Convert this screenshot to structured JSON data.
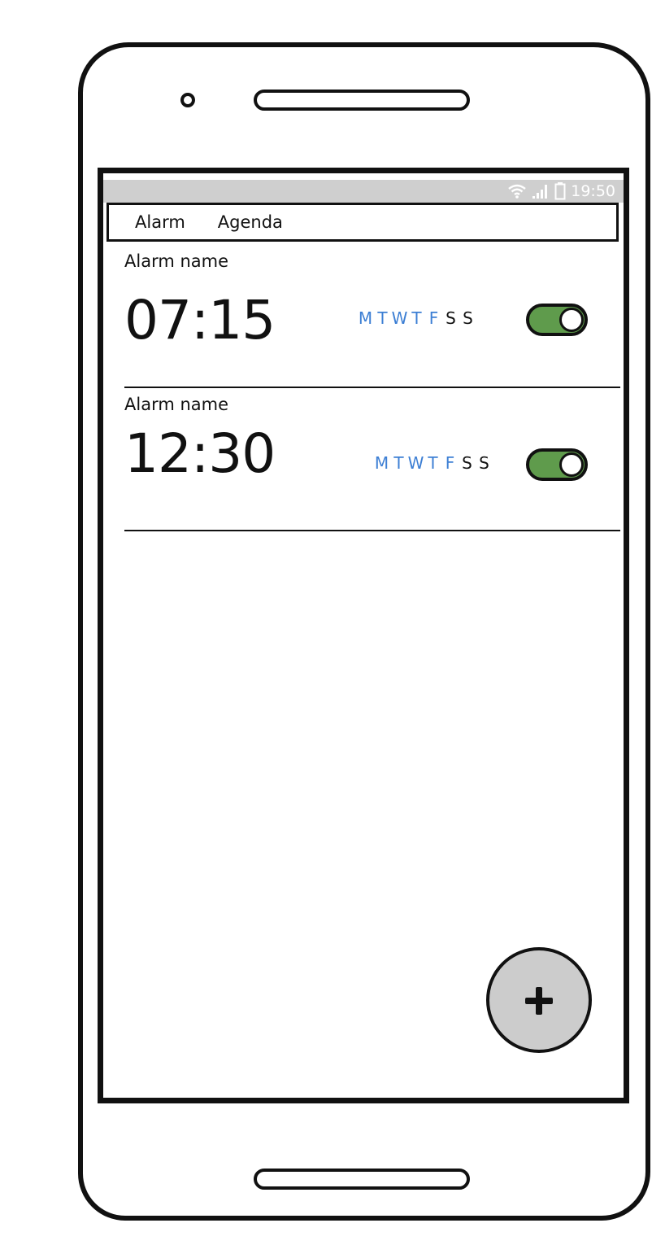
{
  "status_bar": {
    "time": "19:50",
    "icons": [
      "wifi-icon",
      "signal-icon",
      "battery-icon"
    ]
  },
  "tabs": [
    {
      "label": "Alarm"
    },
    {
      "label": "Agenda"
    }
  ],
  "alarms": [
    {
      "name": "Alarm name",
      "time": "07:15",
      "days": [
        {
          "letter": "M",
          "active": true
        },
        {
          "letter": "T",
          "active": true
        },
        {
          "letter": "W",
          "active": true
        },
        {
          "letter": "T",
          "active": true
        },
        {
          "letter": "F",
          "active": true
        },
        {
          "letter": "S",
          "active": false
        },
        {
          "letter": "S",
          "active": false
        }
      ],
      "enabled": true
    },
    {
      "name": "Alarm name",
      "time": "12:30",
      "days": [
        {
          "letter": "M",
          "active": true
        },
        {
          "letter": "T",
          "active": true
        },
        {
          "letter": "W",
          "active": true
        },
        {
          "letter": "T",
          "active": true
        },
        {
          "letter": "F",
          "active": true
        },
        {
          "letter": "S",
          "active": false
        },
        {
          "letter": "S",
          "active": false
        }
      ],
      "enabled": true
    }
  ],
  "colors": {
    "active_day": "#3d7fd4",
    "inactive_day": "#111111",
    "toggle_on": "#5f9b4c",
    "fab": "#cccccc",
    "status_bar": "#cfcfcf"
  },
  "fab": {
    "icon": "plus-icon"
  }
}
